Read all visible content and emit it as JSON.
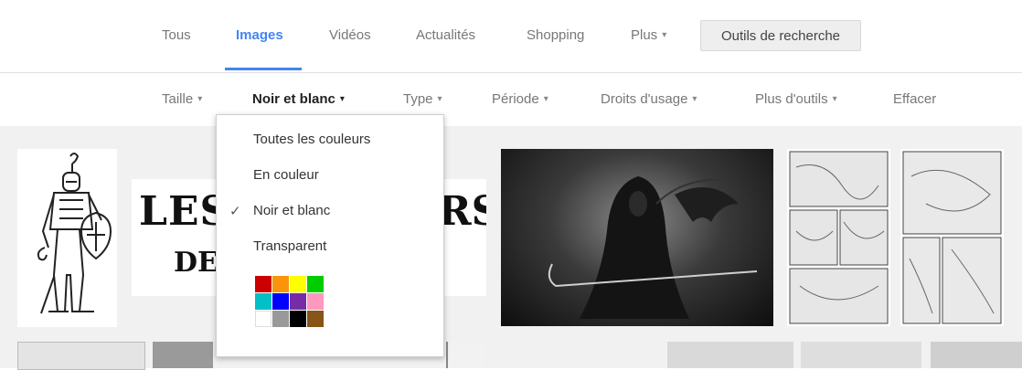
{
  "tabs": [
    {
      "label": "Tous",
      "active": false
    },
    {
      "label": "Images",
      "active": true
    },
    {
      "label": "Vidéos",
      "active": false
    },
    {
      "label": "Actualités",
      "active": false
    },
    {
      "label": "Shopping",
      "active": false
    },
    {
      "label": "Plus",
      "active": false
    }
  ],
  "tab_caret": "▾",
  "search_tools_label": "Outils de recherche",
  "tools": [
    {
      "label": "Taille",
      "active": false
    },
    {
      "label": "Noir et blanc",
      "active": true
    },
    {
      "label": "Type",
      "active": false
    },
    {
      "label": "Période",
      "active": false
    },
    {
      "label": "Droits d'usage",
      "active": false
    },
    {
      "label": "Plus d'outils",
      "active": false
    }
  ],
  "clear_label": "Effacer",
  "color_menu": {
    "items": [
      {
        "label": "Toutes les couleurs",
        "checked": false
      },
      {
        "label": "En couleur",
        "checked": false
      },
      {
        "label": "Noir et blanc",
        "checked": true
      },
      {
        "label": "Transparent",
        "checked": false
      }
    ],
    "check_glyph": "✓",
    "swatches": [
      "#cc0000",
      "#fb940b",
      "#ffff00",
      "#00cc00",
      "#03c0c6",
      "#0000ff",
      "#762ca7",
      "#ff98bf",
      "#ffffff",
      "#999999",
      "#000000",
      "#885418"
    ]
  },
  "image_texts": {
    "logo_line1": "LES",
    "logo_line1_right": "RS",
    "logo_line2": "DE"
  },
  "colors": {
    "accent": "#4285f4"
  }
}
